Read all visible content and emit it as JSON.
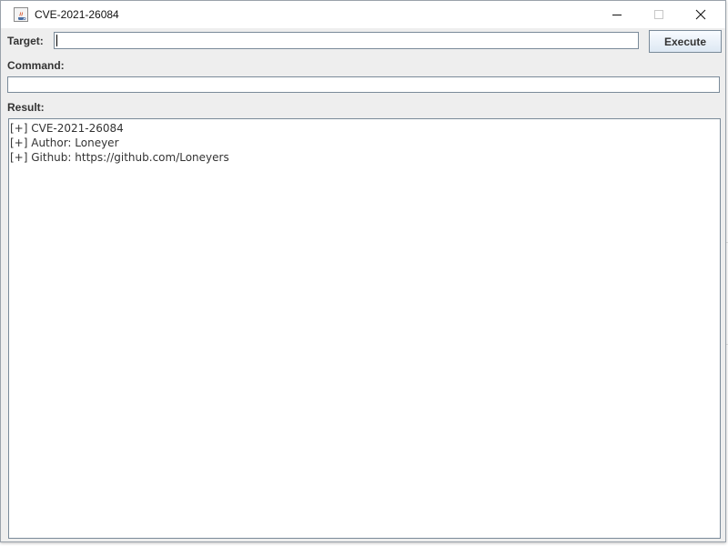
{
  "window": {
    "title": "CVE-2021-26084",
    "minimize_glyph": "—",
    "maximize_glyph": "☐",
    "close_glyph": "✕"
  },
  "form": {
    "target_label": "Target:",
    "target_value": "",
    "execute_label": "Execute",
    "command_label": "Command:",
    "command_value": "",
    "result_label": "Result:"
  },
  "result": {
    "lines": [
      "[+] CVE-2021-26084",
      "[+] Author: Loneyer",
      "[+] Github: https://github.com/Loneyers"
    ]
  },
  "icons": {
    "app": "java-cup-icon",
    "minimize": "minimize-icon",
    "maximize": "maximize-icon",
    "close": "close-icon"
  },
  "colors": {
    "window_bg": "#eeeeee",
    "field_border": "#7a8a99",
    "button_gradient_top": "#f8fbff",
    "button_gradient_bottom": "#dde8f3",
    "text": "#333333",
    "background_link": "#2f6fb5"
  }
}
